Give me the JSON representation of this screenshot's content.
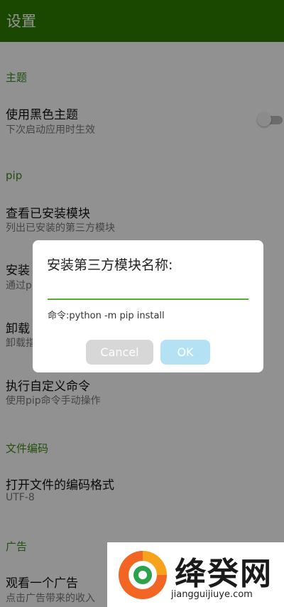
{
  "toolbar": {
    "title": "设置"
  },
  "sections": {
    "theme": "主题",
    "pip": "pip",
    "encoding": "文件编码",
    "ads": "广告"
  },
  "items": {
    "dark_theme": {
      "title": "使用黑色主题",
      "subtitle": "下次启动应用时生效",
      "toggle_on": false
    },
    "list_modules": {
      "title": "查看已安装模块",
      "subtitle": "列出已安装的第三方模块"
    },
    "install": {
      "title": "安装",
      "subtitle": "通过pi"
    },
    "uninstall": {
      "title": "卸载",
      "subtitle": "卸载指"
    },
    "custom_cmd": {
      "title": "执行自定义命令",
      "subtitle": "使用pip命令手动操作"
    },
    "open_encoding": {
      "title": "打开文件的编码格式",
      "subtitle": "UTF-8"
    },
    "watch_ad": {
      "title": "观看一个广告",
      "subtitle": "点击广告带来的收入"
    }
  },
  "dialog": {
    "title": "安装第三方模块名称:",
    "input_value": "",
    "hint": "命令:python -m pip install",
    "cancel_label": "Cancel",
    "ok_label": "OK"
  },
  "watermark": {
    "brand": "绛癸网",
    "url": "jiangguijiuye.com"
  },
  "colors": {
    "toolbar": "#2e7d00",
    "section": "#3b8a18",
    "accent_line": "#5da83b",
    "ok_button": "#b4e2f4",
    "cancel_button": "#d7d7d7"
  }
}
